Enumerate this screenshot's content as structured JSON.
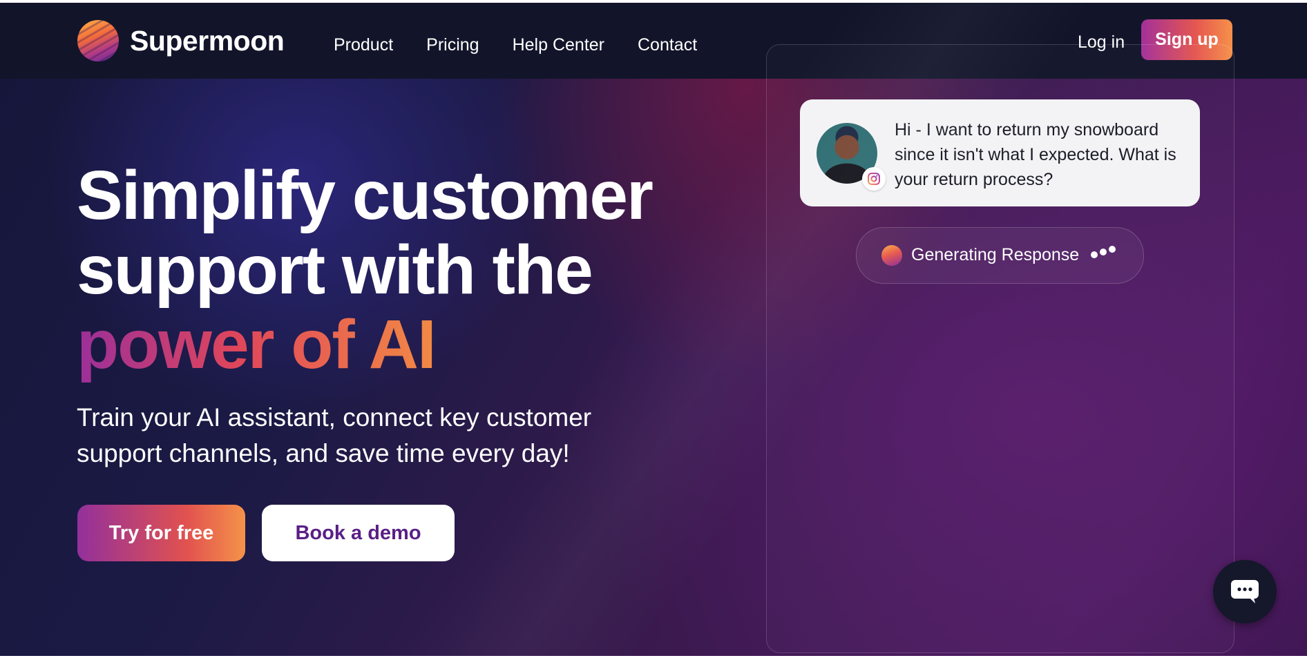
{
  "brand": {
    "name": "Supermoon"
  },
  "nav": {
    "links": [
      "Product",
      "Pricing",
      "Help Center",
      "Contact"
    ],
    "login": "Log in",
    "signup": "Sign up"
  },
  "hero": {
    "headline_line1": "Simplify customer",
    "headline_line2": "support with the",
    "headline_highlight": "power of AI",
    "subtitle": "Train your AI assistant, connect key customer support channels, and save time every day!",
    "cta_primary": "Try for free",
    "cta_secondary": "Book a demo"
  },
  "demo": {
    "message": "Hi - I want to return my snowboard since it isn't what I expected. What is your return process?",
    "channel_icon": "instagram-icon",
    "status": "Generating Response"
  },
  "colors": {
    "nav_bg": "#12152a",
    "accent_start": "#93309c",
    "accent_mid": "#e1524f",
    "accent_end": "#f5924a",
    "demo_text": "#5a1f86"
  },
  "icons": {
    "logo": "supermoon-logo-icon",
    "chat": "chat-bubble-icon",
    "typing": "typing-dots-icon"
  }
}
